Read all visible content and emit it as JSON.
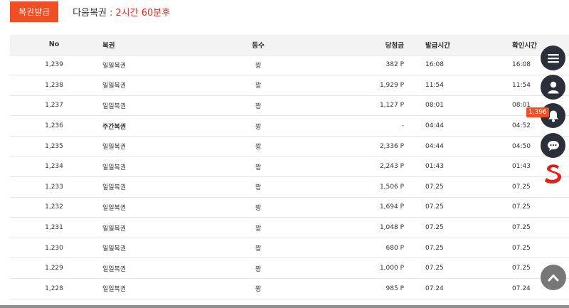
{
  "header": {
    "issue_button": "복권발급",
    "next_label": "다음복권",
    "separator": ":",
    "countdown": "2시간 60분후"
  },
  "table": {
    "columns": {
      "no": "No",
      "name": "복권",
      "grade": "등수",
      "prize": "당첨금",
      "issued": "발급시간",
      "checked": "확인시간"
    },
    "rows": [
      {
        "no": "1,239",
        "name": "일일복권",
        "grade": "꽝",
        "prize": "382 P",
        "issued": "16:08",
        "checked": "16:08"
      },
      {
        "no": "1,238",
        "name": "일일복권",
        "grade": "꽝",
        "prize": "1,929 P",
        "issued": "11:54",
        "checked": "11:54"
      },
      {
        "no": "1,237",
        "name": "일일복권",
        "grade": "꽝",
        "prize": "1,127 P",
        "issued": "08:01",
        "checked": "08:01"
      },
      {
        "no": "1,236",
        "name": "주간복권",
        "grade": "꽝",
        "prize": "-",
        "issued": "04:44",
        "checked": "04:52"
      },
      {
        "no": "1,235",
        "name": "일일복권",
        "grade": "꽝",
        "prize": "2,336 P",
        "issued": "04:44",
        "checked": "04:50"
      },
      {
        "no": "1,234",
        "name": "일일복권",
        "grade": "꽝",
        "prize": "2,243 P",
        "issued": "01:43",
        "checked": "01:43"
      },
      {
        "no": "1,233",
        "name": "일일복권",
        "grade": "꽝",
        "prize": "1,506 P",
        "issued": "07.25",
        "checked": "07.25"
      },
      {
        "no": "1,232",
        "name": "일일복권",
        "grade": "꽝",
        "prize": "1,694 P",
        "issued": "07.25",
        "checked": "07.25"
      },
      {
        "no": "1,231",
        "name": "일일복권",
        "grade": "꽝",
        "prize": "1,048 P",
        "issued": "07.25",
        "checked": "07.25"
      },
      {
        "no": "1,230",
        "name": "일일복권",
        "grade": "꽝",
        "prize": "680 P",
        "issued": "07.25",
        "checked": "07.25"
      },
      {
        "no": "1,229",
        "name": "일일복권",
        "grade": "꽝",
        "prize": "1,000 P",
        "issued": "07.25",
        "checked": "07.25"
      },
      {
        "no": "1,228",
        "name": "일일복권",
        "grade": "꽝",
        "prize": "985 P",
        "issued": "07.24",
        "checked": "07.24"
      }
    ]
  },
  "sidebar": {
    "notification_count": "1,396",
    "icons": [
      "menu-icon",
      "user-icon",
      "bell-icon",
      "chat-icon",
      "s-logo-icon",
      "scroll-top-icon"
    ]
  },
  "colors": {
    "accent": "#f04e23",
    "countdown": "#e0301e",
    "side_button": "#2a2f3a",
    "top_button": "#777777"
  }
}
